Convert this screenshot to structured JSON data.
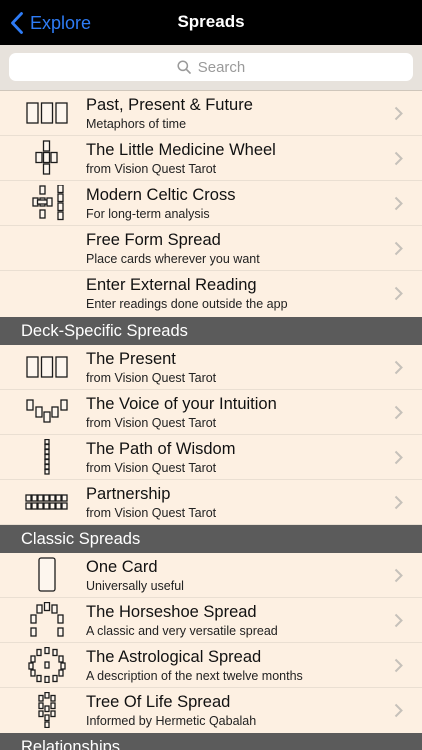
{
  "nav": {
    "back_label": "Explore",
    "title": "Spreads"
  },
  "search": {
    "placeholder": "Search"
  },
  "groups": [
    {
      "header": "",
      "items": [
        {
          "title": "Past, Present & Future",
          "subtitle": "Metaphors of time",
          "icon": "three-card-icon"
        },
        {
          "title": "The Little Medicine Wheel",
          "subtitle": "from Vision Quest Tarot",
          "icon": "cross-spread-icon"
        },
        {
          "title": "Modern Celtic Cross",
          "subtitle": "For long-term analysis",
          "icon": "celtic-cross-icon"
        },
        {
          "title": "Free Form Spread",
          "subtitle": "Place cards wherever you want",
          "icon": ""
        },
        {
          "title": "Enter External Reading",
          "subtitle": "Enter readings done outside the app",
          "icon": ""
        }
      ]
    },
    {
      "header": "Deck-Specific Spreads",
      "items": [
        {
          "title": "The Present",
          "subtitle": "from Vision Quest Tarot",
          "icon": "three-card-icon"
        },
        {
          "title": "The Voice of your Intuition",
          "subtitle": "from Vision Quest Tarot",
          "icon": "arc-spread-icon"
        },
        {
          "title": "The Path of Wisdom",
          "subtitle": "from Vision Quest Tarot",
          "icon": "column-spread-icon"
        },
        {
          "title": "Partnership",
          "subtitle": "from Vision Quest Tarot",
          "icon": "grid-spread-icon"
        }
      ]
    },
    {
      "header": "Classic Spreads",
      "items": [
        {
          "title": "One Card",
          "subtitle": "Universally useful",
          "icon": "single-card-icon"
        },
        {
          "title": "The Horseshoe Spread",
          "subtitle": "A classic and very versatile spread",
          "icon": "horseshoe-icon"
        },
        {
          "title": "The Astrological Spread",
          "subtitle": "A description of the next twelve months",
          "icon": "circle-spread-icon"
        },
        {
          "title": "Tree Of Life Spread",
          "subtitle": "Informed by Hermetic Qabalah",
          "icon": "tree-of-life-icon"
        }
      ]
    },
    {
      "header": "Relationships",
      "items": []
    }
  ]
}
